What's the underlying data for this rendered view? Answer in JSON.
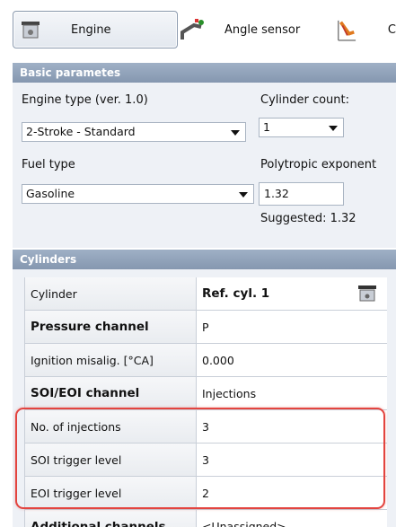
{
  "toolbar": {
    "engine_label": "Engine",
    "angle_sensor_label": "Angle sensor",
    "combustion_label": "C"
  },
  "basic": {
    "header": "Basic parametes",
    "engine_type_label": "Engine type (ver. 1.0)",
    "engine_type_value": "2-Stroke - Standard",
    "cylinder_count_label": "Cylinder count:",
    "cylinder_count_value": "1",
    "fuel_type_label": "Fuel type",
    "fuel_type_value": "Gasoline",
    "polytropic_label": "Polytropic exponent",
    "polytropic_value": "1.32",
    "suggested_label": "Suggested: 1.32"
  },
  "cylinders": {
    "header": "Cylinders",
    "rows": [
      {
        "name": "Cylinder",
        "value": "Ref. cyl. 1"
      },
      {
        "name": "Pressure channel",
        "value": "P"
      },
      {
        "name": "Ignition misalig. [°CA]",
        "value": "0.000"
      },
      {
        "name": "SOI/EOI channel",
        "value": "Injections"
      },
      {
        "name": "No. of injections",
        "value": "3"
      },
      {
        "name": "SOI trigger level",
        "value": "3"
      },
      {
        "name": "EOI trigger level",
        "value": "2"
      },
      {
        "name": "Additional channels",
        "value": "<Unassigned>"
      }
    ]
  },
  "colors": {
    "section_header": "#8fa1b9",
    "panel_bg": "#eef1f6",
    "highlight": "#e3443f"
  }
}
